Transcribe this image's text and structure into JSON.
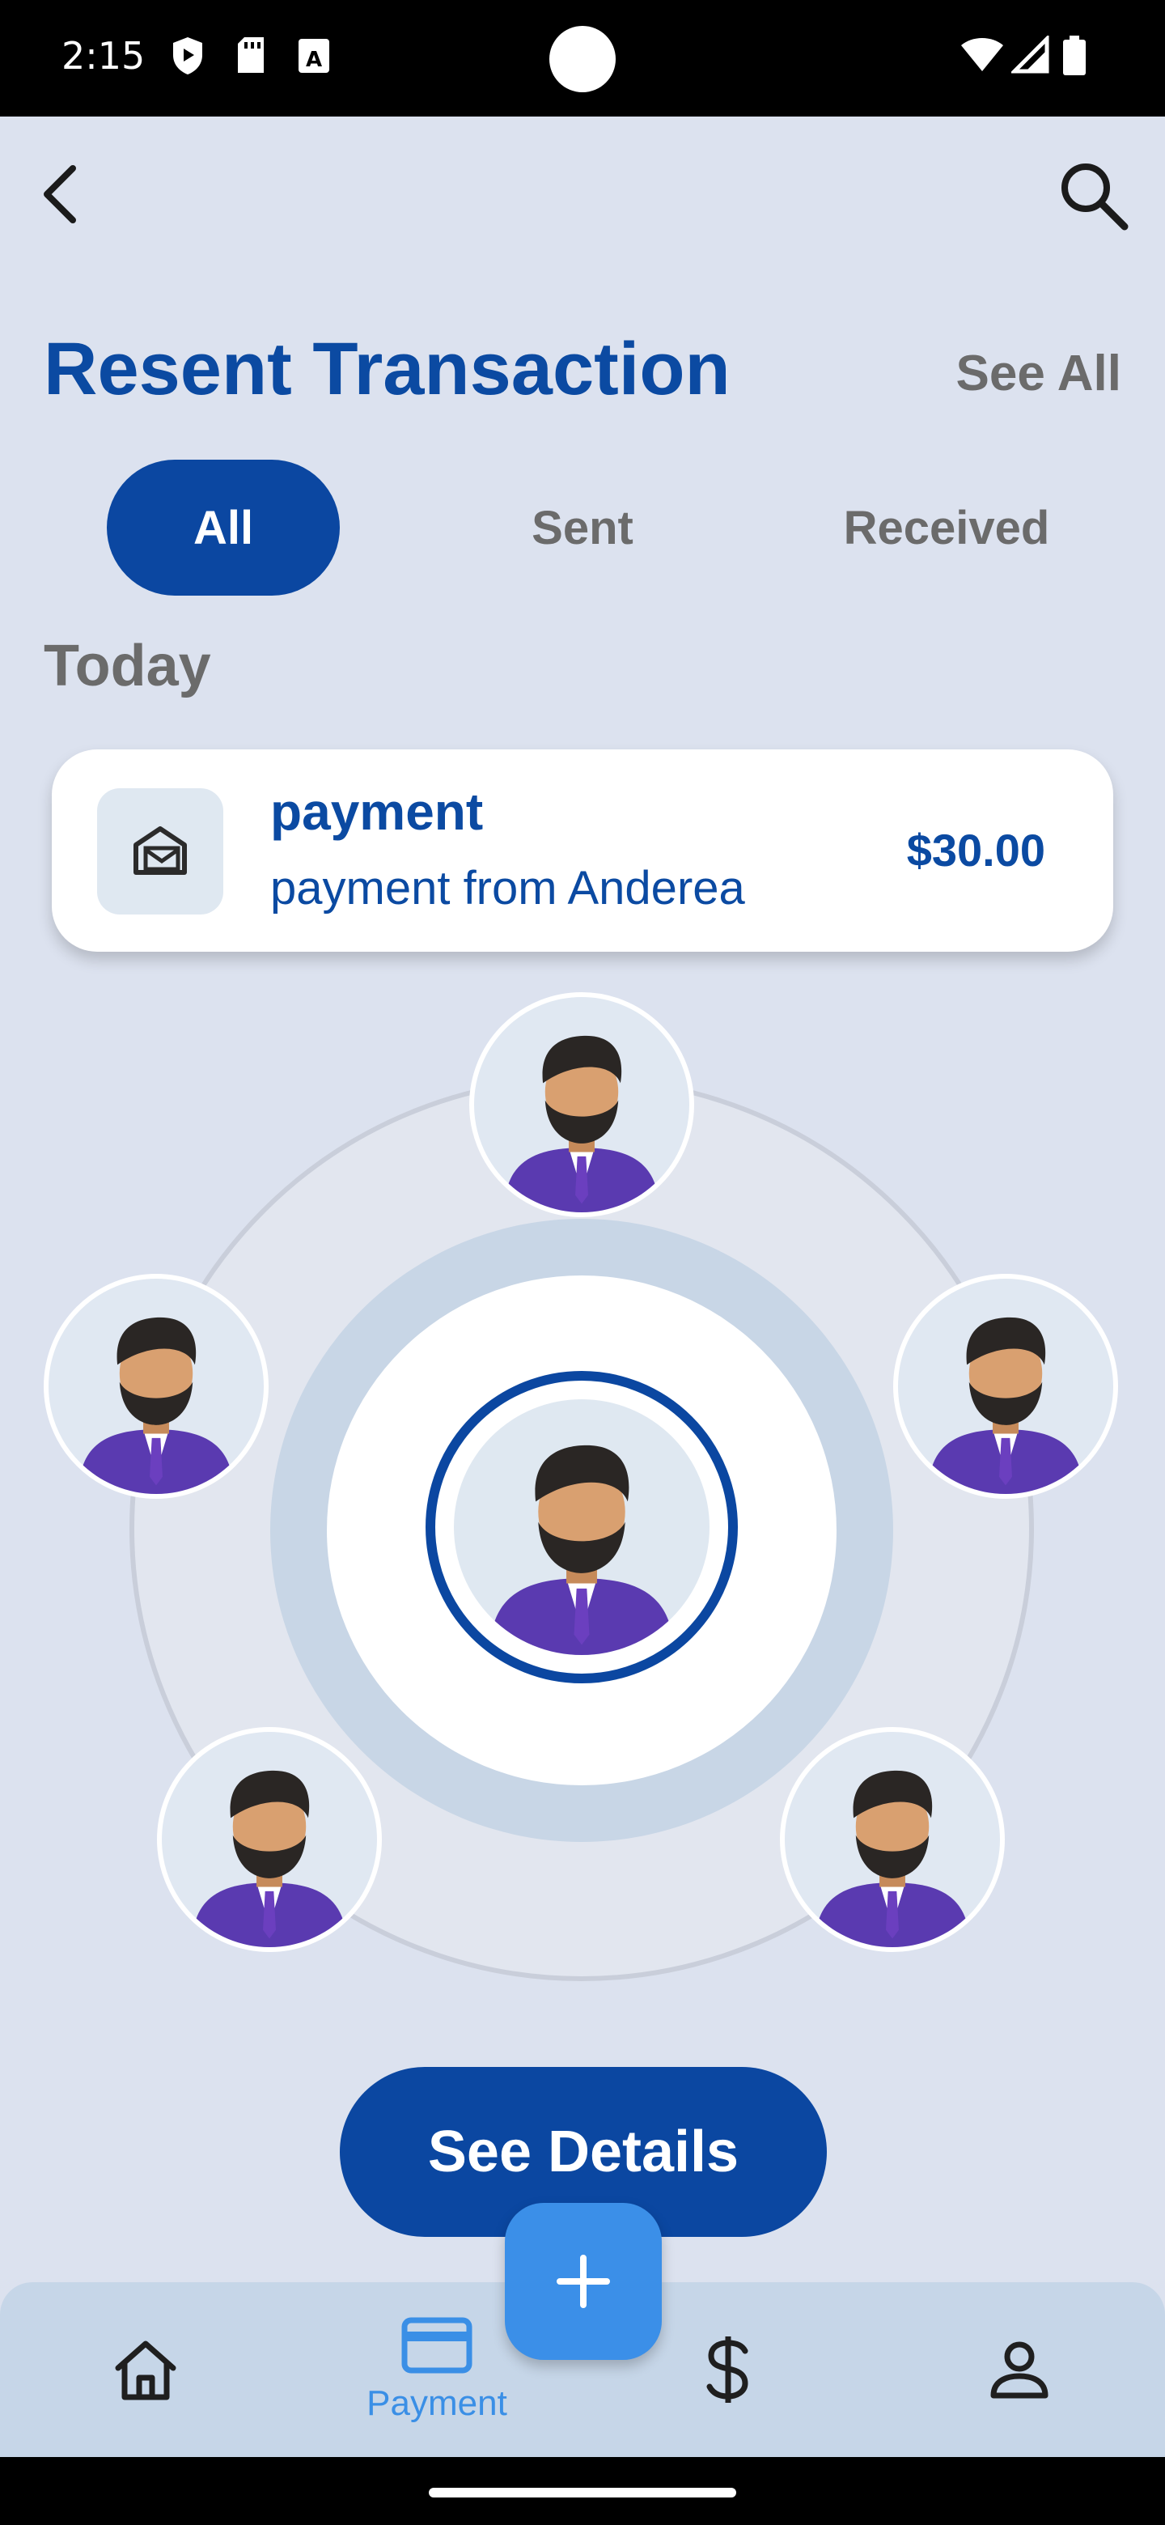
{
  "status_bar": {
    "time": "2:15"
  },
  "header": {
    "back_icon": "chevron-left-icon",
    "search_icon": "search-icon"
  },
  "section": {
    "title": "Resent Transaction",
    "see_all": "See All"
  },
  "tabs": [
    {
      "label": "All",
      "active": true
    },
    {
      "label": "Sent",
      "active": false
    },
    {
      "label": "Received",
      "active": false
    }
  ],
  "group_label": "Today",
  "transaction": {
    "title": "payment",
    "subtitle": "payment from Anderea",
    "amount": "$30.00",
    "icon": "mail-open-icon"
  },
  "details_button": "See Details",
  "bottom_nav": {
    "items": [
      {
        "icon": "home-icon",
        "label": ""
      },
      {
        "icon": "credit-card-icon",
        "label": "Payment",
        "active": true
      },
      {
        "icon": "dollar-icon",
        "label": ""
      },
      {
        "icon": "user-icon",
        "label": ""
      }
    ],
    "fab_icon": "plus-icon"
  },
  "colors": {
    "primary": "#0b47a1",
    "accent": "#3b8fe8",
    "background": "#dce2ef"
  }
}
